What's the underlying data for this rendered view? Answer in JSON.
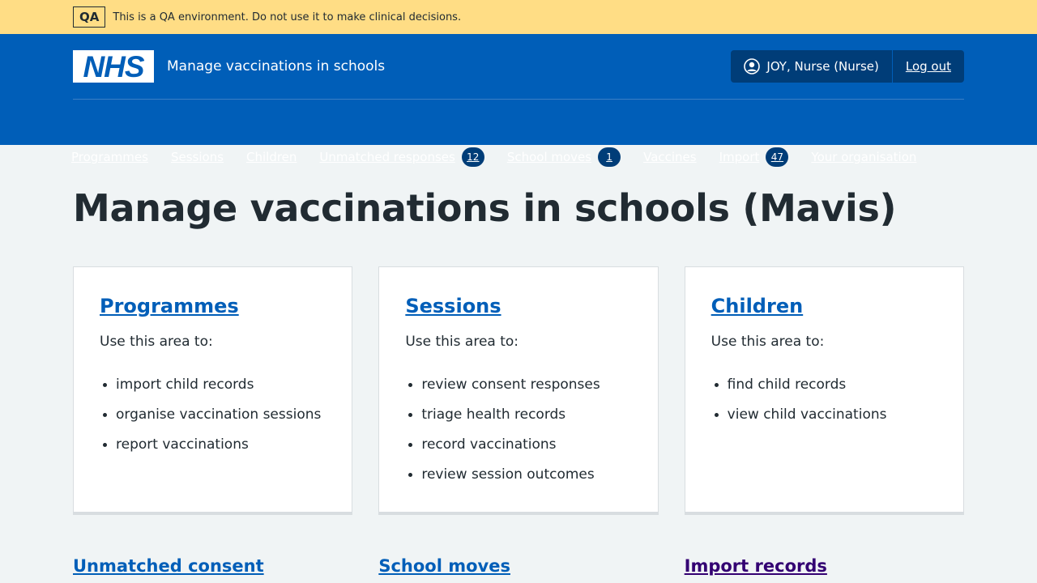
{
  "qa_banner": {
    "tag": "QA",
    "message": "This is a QA environment. Do not use it to make clinical decisions."
  },
  "header": {
    "logo_text": "NHS",
    "service_name": "Manage vaccinations in schools",
    "user_name": "JOY, Nurse (Nurse)",
    "logout_label": "Log out",
    "user_icon": "user-circle-icon"
  },
  "nav": {
    "items": [
      {
        "label": "Programmes",
        "count": null
      },
      {
        "label": "Sessions",
        "count": null
      },
      {
        "label": "Children",
        "count": null
      },
      {
        "label": "Unmatched responses",
        "count": "12"
      },
      {
        "label": "School moves",
        "count": "1"
      },
      {
        "label": "Vaccines",
        "count": null
      },
      {
        "label": "Import",
        "count": "47"
      },
      {
        "label": "Your organisation",
        "count": null
      }
    ]
  },
  "main": {
    "title": "Manage vaccinations in schools (Mavis)",
    "cards": [
      {
        "title": "Programmes",
        "lead": "Use this area to:",
        "items": [
          "import child records",
          "organise vaccination sessions",
          "report vaccinations"
        ]
      },
      {
        "title": "Sessions",
        "lead": "Use this area to:",
        "items": [
          "review consent responses",
          "triage health records",
          "record vaccinations",
          "review session outcomes"
        ]
      },
      {
        "title": "Children",
        "lead": "Use this area to:",
        "items": [
          "find child records",
          "view child vaccinations"
        ]
      }
    ],
    "bottom_links": [
      "Unmatched consent responses",
      "School moves",
      "Import records"
    ]
  },
  "colors": {
    "qa_banner": "#ffdd85",
    "header": "#005eb8",
    "account_bg": "#003d78",
    "link": "#005eb8",
    "visited_link": "#330072",
    "page_bg": "#f0f4f5"
  }
}
